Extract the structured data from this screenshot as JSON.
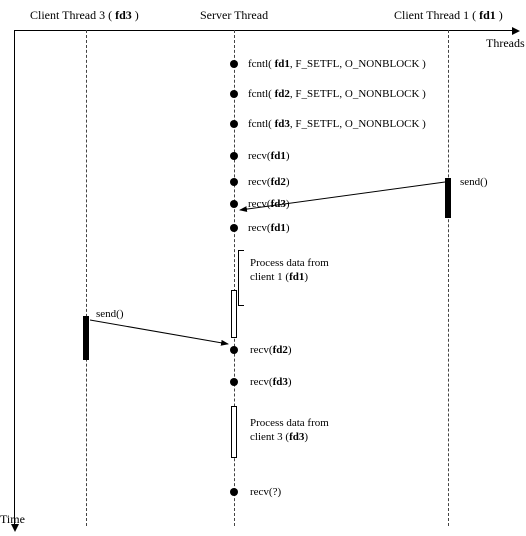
{
  "axes": {
    "x_label": "Threads",
    "y_label": "Time"
  },
  "threads": {
    "client3": {
      "title_prefix": "Client Thread 3 ( ",
      "fd": "fd3",
      "title_suffix": " )"
    },
    "server": {
      "title": "Server Thread"
    },
    "client1": {
      "title_prefix": "Client Thread 1 ( ",
      "fd": "fd1",
      "title_suffix": " )"
    }
  },
  "events": {
    "e1": {
      "pre": "fcntl( ",
      "fd": "fd1",
      "post": ", F_SETFL, O_NONBLOCK )"
    },
    "e2": {
      "pre": "fcntl( ",
      "fd": "fd2",
      "post": ", F_SETFL, O_NONBLOCK )"
    },
    "e3": {
      "pre": "fcntl( ",
      "fd": "fd3",
      "post": ", F_SETFL, O_NONBLOCK )"
    },
    "e4": {
      "pre": "recv(",
      "fd": "fd1",
      "post": ")"
    },
    "e5": {
      "pre": "recv(",
      "fd": "fd2",
      "post": ")"
    },
    "e6": {
      "pre": "recv(",
      "fd": "fd3",
      "post": ")"
    },
    "e7": {
      "pre": "recv(",
      "fd": "fd1",
      "post": ")"
    },
    "e8": {
      "pre": "recv(",
      "fd": "fd2",
      "post": ")"
    },
    "e9": {
      "pre": "recv(",
      "fd": "fd3",
      "post": ")"
    },
    "e10": {
      "pre": "recv(",
      "fd": "?",
      "post": ")"
    }
  },
  "process": {
    "p1_l1": "Process data from",
    "p1_l2_pre": "client 1 (",
    "p1_l2_fd": "fd1",
    "p1_l2_post": ")",
    "p2_l1": "Process data from",
    "p2_l2_pre": "client 3 (",
    "p2_l2_fd": "fd3",
    "p2_l2_post": ")"
  },
  "messages": {
    "send1": "send()",
    "send3": "send()"
  },
  "chart_data": {
    "type": "sequence-diagram",
    "lifelines": [
      {
        "id": "client3",
        "label": "Client Thread 3 (fd3)"
      },
      {
        "id": "server",
        "label": "Server Thread"
      },
      {
        "id": "client1",
        "label": "Client Thread 1 (fd1)"
      }
    ],
    "server_events": [
      "fcntl(fd1, F_SETFL, O_NONBLOCK)",
      "fcntl(fd2, F_SETFL, O_NONBLOCK)",
      "fcntl(fd3, F_SETFL, O_NONBLOCK)",
      "recv(fd1)",
      "recv(fd2)",
      "recv(fd3)",
      "recv(fd1)",
      "Process data from client 1 (fd1)",
      "recv(fd2)",
      "recv(fd3)",
      "Process data from client 3 (fd3)",
      "recv(?)"
    ],
    "messages": [
      {
        "from": "client1",
        "to": "server",
        "label": "send()",
        "arrives_before": "recv(fd1) #2"
      },
      {
        "from": "client3",
        "to": "server",
        "label": "send()",
        "arrives_before": "recv(fd2) #2"
      }
    ]
  }
}
